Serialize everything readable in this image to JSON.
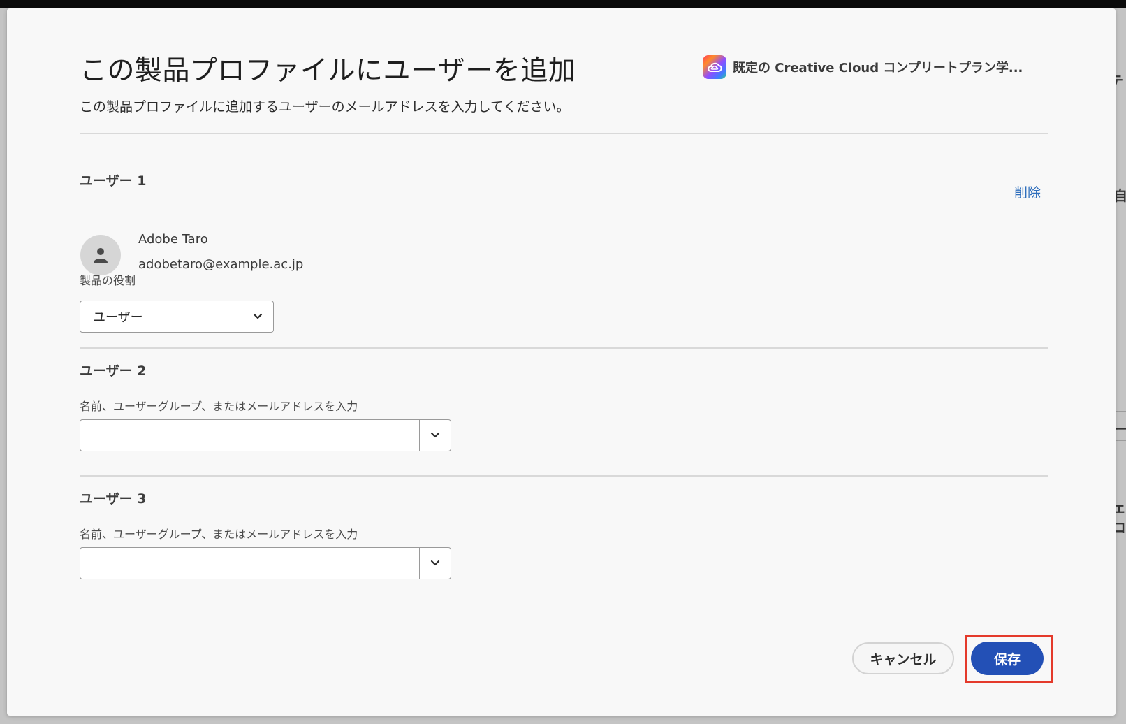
{
  "background": {
    "fragments": [
      "テ",
      "自",
      "ー",
      "ェコ"
    ]
  },
  "dialog": {
    "title": "この製品プロファイルにユーザーを追加",
    "subtitle": "この製品プロファイルに追加するユーザーのメールアドレスを入力してください。",
    "product": {
      "icon": "creative-cloud-icon",
      "name": "既定の Creative Cloud コンプリートプラン学..."
    }
  },
  "users": [
    {
      "heading": "ユーザー 1",
      "delete_label": "削除",
      "name": "Adobe Taro",
      "email": "adobetaro@example.ac.jp",
      "role_label": "製品の役割",
      "role_value": "ユーザー"
    },
    {
      "heading": "ユーザー 2",
      "input_label": "名前、ユーザーグループ、またはメールアドレスを入力",
      "input_value": ""
    },
    {
      "heading": "ユーザー 3",
      "input_label": "名前、ユーザーグループ、またはメールアドレスを入力",
      "input_value": ""
    }
  ],
  "footer": {
    "cancel_label": "キャンセル",
    "save_label": "保存"
  },
  "colors": {
    "primary": "#2350b6",
    "link": "#2f6fbd",
    "highlight": "#e43a2b"
  }
}
